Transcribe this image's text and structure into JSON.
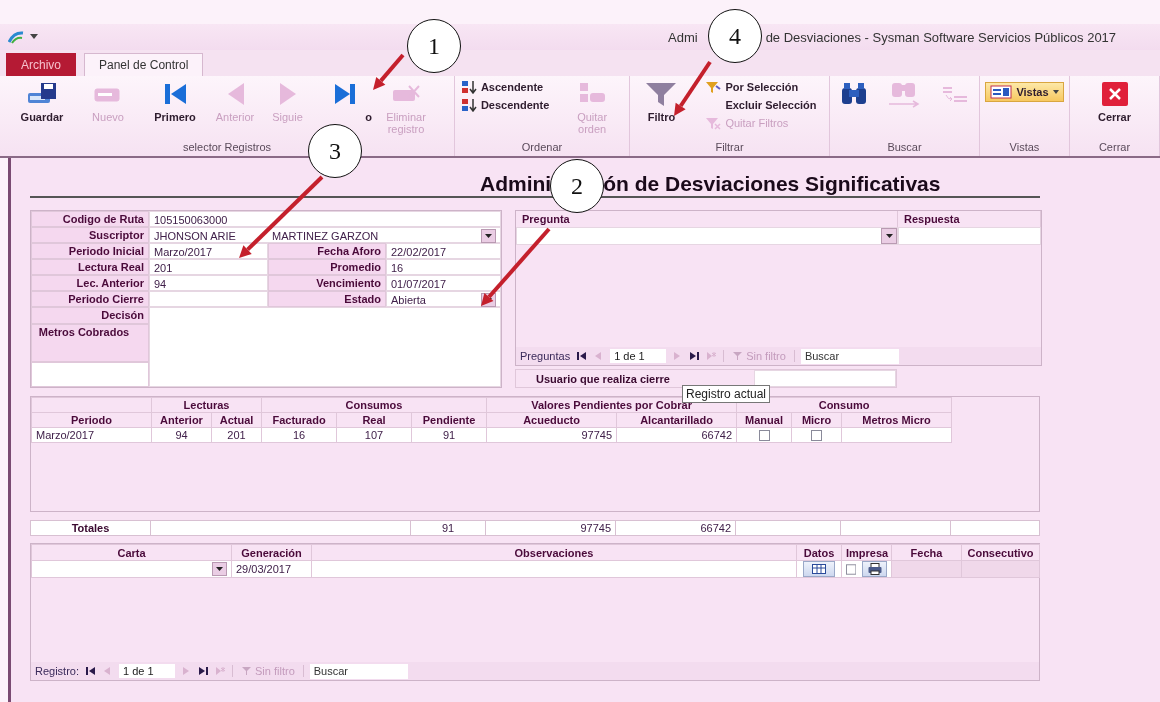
{
  "window": {
    "title_left": "Admi",
    "title_right": "de Desviaciones  -  Sysman Software Servicios Públicos 2017"
  },
  "tabs": [
    {
      "label": "Archivo",
      "kind": "file",
      "selected": false
    },
    {
      "label": "Panel de Control",
      "kind": "tab",
      "selected": true
    }
  ],
  "ribbon": [
    {
      "label": "selector Registros",
      "items": [
        {
          "kind": "big",
          "label": "Guardar",
          "disabled": false
        },
        {
          "kind": "big",
          "label": "Nuevo",
          "disabled": true
        },
        {
          "kind": "big",
          "label": "Primero",
          "disabled": false
        },
        {
          "kind": "big",
          "label": "Anterior",
          "disabled": true
        },
        {
          "kind": "big",
          "label": "Siguie",
          "disabled": true
        },
        {
          "kind": "big",
          "label": "o",
          "disabled": false
        },
        {
          "kind": "big",
          "label": "Eliminar registro",
          "disabled": true
        }
      ]
    },
    {
      "label": "Ordenar",
      "items": [
        {
          "kind": "stack",
          "entries": [
            {
              "label": "Ascendente",
              "disabled": false
            },
            {
              "label": "Descendente",
              "disabled": false
            }
          ]
        },
        {
          "kind": "big",
          "label": "Quitar orden",
          "disabled": true
        }
      ]
    },
    {
      "label": "Filtrar",
      "items": [
        {
          "kind": "big",
          "label": "Filtro",
          "disabled": false
        },
        {
          "kind": "stack",
          "entries": [
            {
              "label": "Por Selección",
              "disabled": false
            },
            {
              "label": "Excluir Selección",
              "disabled": false
            },
            {
              "label": "Quitar Filtros",
              "disabled": true
            }
          ]
        }
      ]
    },
    {
      "label": "Buscar",
      "items": [
        {
          "kind": "big",
          "disabled": false
        },
        {
          "kind": "big",
          "disabled": true
        },
        {
          "kind": "big",
          "disabled": true
        }
      ]
    },
    {
      "label": "Vistas",
      "items": [
        {
          "kind": "split",
          "label": "Vistas",
          "disabled": false
        }
      ]
    },
    {
      "label": "Cerrar",
      "items": [
        {
          "kind": "big",
          "label": "Cerrar",
          "disabled": false
        }
      ]
    }
  ],
  "form": {
    "title_left": "Admini",
    "title_right": "ón de Desviaciones Significativas",
    "record": {
      "rows": [
        [
          {
            "label": "Codigo de Ruta",
            "value": "105150063000",
            "dropdown": false
          }
        ],
        [
          {
            "label": "Suscriptor",
            "value_parts": [
              "JHONSON ARIE",
              "MARTINEZ GARZON"
            ],
            "dropdown": true
          }
        ],
        [
          {
            "label": "Periodo Inicial",
            "value": "Marzo/2017",
            "dropdown": false
          },
          {
            "label": "Fecha Aforo",
            "value": "22/02/2017",
            "dropdown": false
          }
        ],
        [
          {
            "label": "Lectura Real",
            "value": "201",
            "dropdown": false
          },
          {
            "label": "Promedio",
            "value": "16",
            "dropdown": false
          }
        ],
        [
          {
            "label": "Lec. Anterior",
            "value": "94",
            "dropdown": false
          },
          {
            "label": "Vencimiento",
            "value": "01/07/2017",
            "dropdown": false
          }
        ],
        [
          {
            "label": "Periodo Cierre",
            "dropdown": false
          },
          {
            "label": "Estado",
            "value": "Abierta",
            "dropdown": true
          }
        ]
      ],
      "memo_labels": [
        "Decisón",
        "Metros Cobrados"
      ]
    },
    "questions": {
      "columns": [
        "Pregunta",
        "Respuesta"
      ],
      "nav": {
        "label": "Preguntas",
        "position": "1 de 1",
        "filter": "Sin filtro",
        "search": {
          "placeholder": "Buscar"
        }
      },
      "closing_user": {
        "label": "Usuario que realiza cierre"
      }
    },
    "tooltip": "Registro actual",
    "readings": {
      "groups": [
        {
          "columns": [
            {
              "label": "Periodo",
              "kind": "text"
            }
          ]
        },
        {
          "label": "Lecturas",
          "columns": [
            {
              "label": "Anterior",
              "kind": "number"
            },
            {
              "label": "Actual",
              "kind": "number"
            }
          ]
        },
        {
          "label": "Consumos",
          "columns": [
            {
              "label": "Facturado",
              "kind": "number"
            },
            {
              "label": "Real",
              "kind": "number"
            },
            {
              "label": "Pendiente",
              "kind": "number"
            }
          ]
        },
        {
          "label": "Valores Pendientes por Cobrar",
          "columns": [
            {
              "label": "Acueducto",
              "kind": "amount"
            },
            {
              "label": "Alcantarillado",
              "kind": "amount"
            }
          ]
        },
        {
          "label": "Consumo",
          "columns": [
            {
              "label": "Manual",
              "kind": "check"
            },
            {
              "label": "Micro",
              "kind": "check"
            },
            {
              "label": "Metros Micro",
              "kind": "text"
            }
          ]
        }
      ],
      "rows": [
        {
          "values": [
            "Marzo/2017",
            "94",
            "201",
            "16",
            "107",
            "91",
            "97745",
            "66742"
          ],
          "checks": [
            false,
            false
          ]
        }
      ],
      "totals": {
        "label": "Totales",
        "values": [
          "91",
          "97745",
          "66742"
        ]
      }
    },
    "letters": {
      "columns": [
        {
          "label": "Carta",
          "kind": "combo"
        },
        {
          "label": "Generación",
          "kind": "date"
        },
        {
          "label": "Observaciones",
          "kind": "text"
        },
        {
          "label": "Datos",
          "kind": "data-button"
        },
        {
          "label": "Impresa",
          "kind": "print"
        },
        {
          "label": "Fecha",
          "kind": "locked"
        },
        {
          "label": "Consecutivo",
          "kind": "locked"
        }
      ],
      "rows": [
        {
          "date": "29/03/2017",
          "printed": false
        }
      ]
    },
    "nav": {
      "label": "Registro:",
      "position": "1 de 1",
      "filter": "Sin filtro",
      "search": {
        "placeholder": "Buscar"
      }
    }
  },
  "annotations": [
    {
      "label": "1"
    },
    {
      "label": "4"
    },
    {
      "label": "3"
    },
    {
      "label": "2"
    }
  ]
}
